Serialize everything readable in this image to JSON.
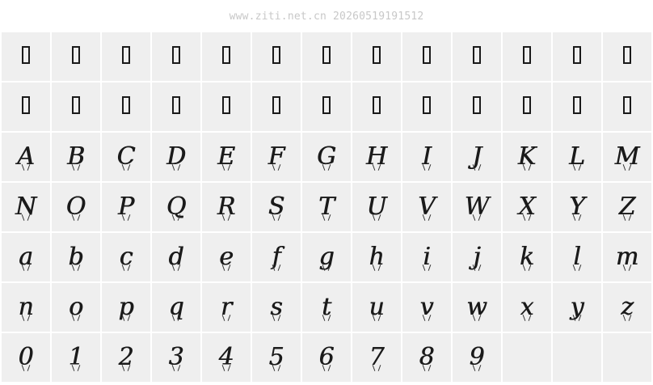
{
  "header": {
    "watermark": "www.ziti.net.cn 20260519191512"
  },
  "rows": [
    [
      "",
      "",
      "",
      "",
      "",
      "",
      "",
      "",
      "",
      "",
      "",
      "",
      ""
    ],
    [
      "",
      "",
      "",
      "",
      "",
      "",
      "",
      "",
      "",
      "",
      "",
      "",
      ""
    ],
    [
      "A",
      "B",
      "C",
      "D",
      "E",
      "F",
      "G",
      "H",
      "I",
      "J",
      "K",
      "L",
      "M"
    ],
    [
      "N",
      "O",
      "P",
      "Q",
      "R",
      "S",
      "T",
      "U",
      "V",
      "W",
      "X",
      "Y",
      "Z"
    ],
    [
      "a",
      "b",
      "c",
      "d",
      "e",
      "f",
      "g",
      "h",
      "i",
      "j",
      "k",
      "l",
      "m"
    ],
    [
      "n",
      "o",
      "p",
      "q",
      "r",
      "s",
      "t",
      "u",
      "v",
      "w",
      "x",
      "y",
      "z"
    ],
    [
      "0",
      "1",
      "2",
      "3",
      "4",
      "5",
      "6",
      "7",
      "8",
      "9",
      null,
      null,
      null
    ]
  ]
}
